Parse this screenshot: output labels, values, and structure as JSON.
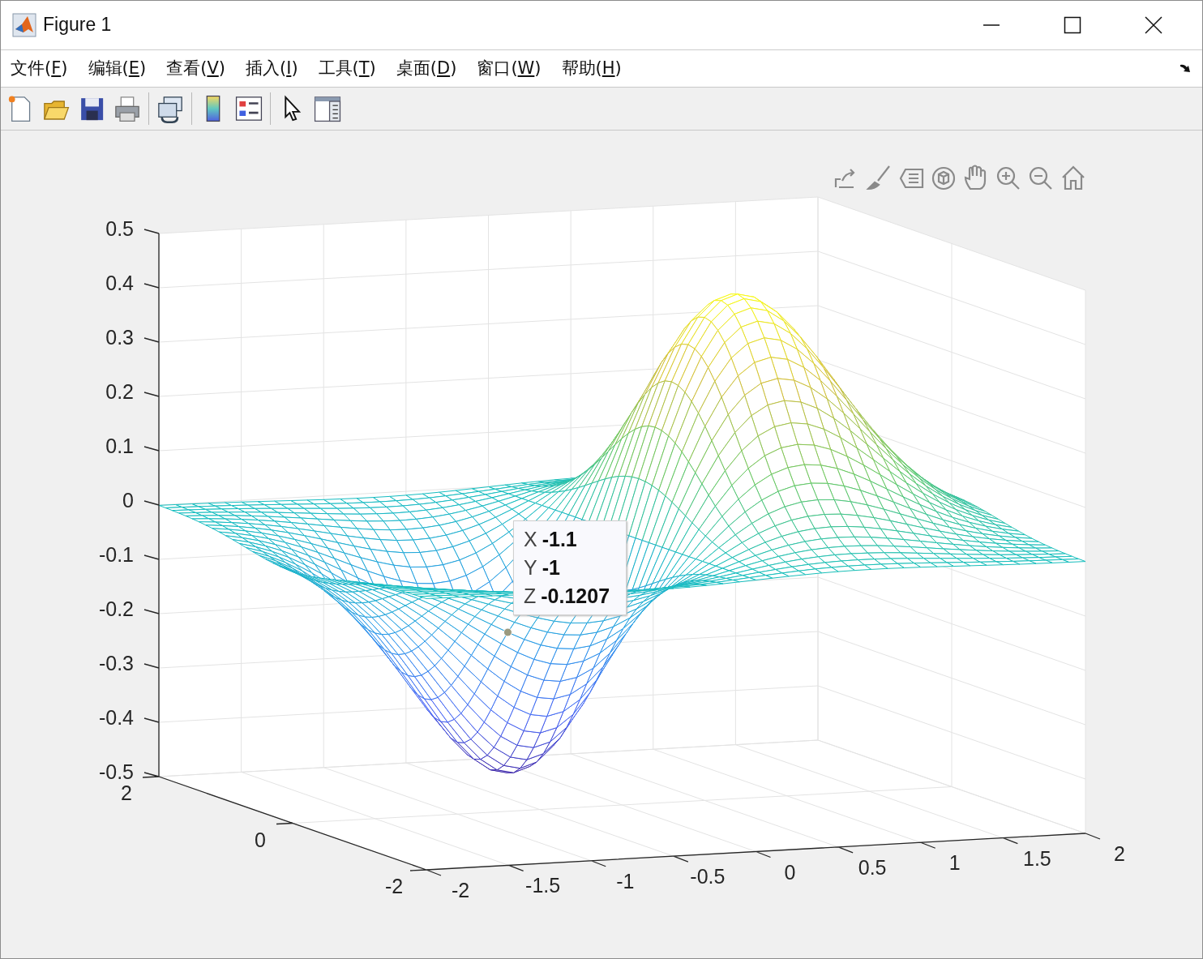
{
  "window": {
    "title": "Figure 1"
  },
  "menu": [
    {
      "label": "文件(F)"
    },
    {
      "label": "编辑(E)"
    },
    {
      "label": "查看(V)"
    },
    {
      "label": "插入(I)"
    },
    {
      "label": "工具(T)"
    },
    {
      "label": "桌面(D)"
    },
    {
      "label": "窗口(W)"
    },
    {
      "label": "帮助(H)"
    }
  ],
  "axes": {
    "zticks": [
      "0.5",
      "0.4",
      "0.3",
      "0.2",
      "0.1",
      "0",
      "-0.1",
      "-0.2",
      "-0.3",
      "-0.4",
      "-0.5"
    ],
    "xticks": [
      "-2",
      "-1.5",
      "-1",
      "-0.5",
      "0",
      "0.5",
      "1",
      "1.5",
      "2"
    ],
    "yticks": [
      "2",
      "0",
      "-2"
    ]
  },
  "datatip": {
    "rows": [
      {
        "axis": "X",
        "value": "-1.1"
      },
      {
        "axis": "Y",
        "value": "-1"
      },
      {
        "axis": "Z",
        "value": "-0.1207"
      }
    ]
  }
}
